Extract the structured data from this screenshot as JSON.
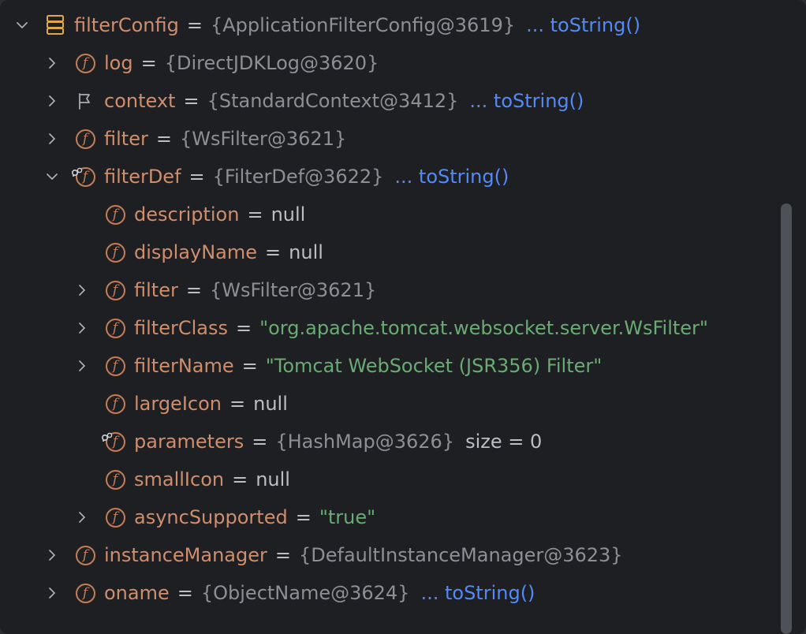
{
  "rows": [
    {
      "chev": "down",
      "icon": "stack",
      "name": "filterConfig",
      "eq": "=",
      "obj": "{ApplicationFilterConfig@3619}",
      "link": "... toString()"
    },
    {
      "chev": "right",
      "icon": "field",
      "name": "log",
      "eq": "=",
      "obj": "{DirectJDKLog@3620}"
    },
    {
      "chev": "right",
      "icon": "flag",
      "name": "context",
      "eq": "=",
      "obj": "{StandardContext@3412}",
      "link": "... toString()"
    },
    {
      "chev": "right",
      "icon": "field",
      "name": "filter",
      "eq": "=",
      "obj": "{WsFilter@3621}"
    },
    {
      "chev": "down",
      "icon": "field-watch",
      "name": "filterDef",
      "eq": "=",
      "obj": "{FilterDef@3622}",
      "link": "... toString()"
    },
    {
      "chev": "",
      "icon": "field",
      "name": "description",
      "eq": "=",
      "null": "null"
    },
    {
      "chev": "",
      "icon": "field",
      "name": "displayName",
      "eq": "=",
      "null": "null"
    },
    {
      "chev": "right",
      "icon": "field",
      "name": "filter",
      "eq": "=",
      "obj": "{WsFilter@3621}"
    },
    {
      "chev": "right",
      "icon": "field",
      "name": "filterClass",
      "eq": "=",
      "str": "\"org.apache.tomcat.websocket.server.WsFilter\""
    },
    {
      "chev": "right",
      "icon": "field",
      "name": "filterName",
      "eq": "=",
      "str": "\"Tomcat WebSocket (JSR356) Filter\""
    },
    {
      "chev": "",
      "icon": "field",
      "name": "largeIcon",
      "eq": "=",
      "null": "null"
    },
    {
      "chev": "",
      "icon": "field-watch",
      "name": "parameters",
      "eq": "=",
      "obj": "{HashMap@3626}",
      "size": "size = 0"
    },
    {
      "chev": "",
      "icon": "field",
      "name": "smallIcon",
      "eq": "=",
      "null": "null"
    },
    {
      "chev": "right",
      "icon": "field",
      "name": "asyncSupported",
      "eq": "=",
      "str": "\"true\""
    },
    {
      "chev": "right",
      "icon": "field",
      "name": "instanceManager",
      "eq": "=",
      "obj": "{DefaultInstanceManager@3623}"
    },
    {
      "chev": "right",
      "icon": "field",
      "name": "oname",
      "eq": "=",
      "obj": "{ObjectName@3624}",
      "link": "... toString()"
    }
  ],
  "field_letter": "f",
  "colors": {
    "background": "#1e1f22",
    "field_name": "#cf8e6d",
    "object_ref": "#8c8f94",
    "string_value": "#6aab73",
    "link": "#548af7",
    "default_text": "#bcbec4"
  }
}
